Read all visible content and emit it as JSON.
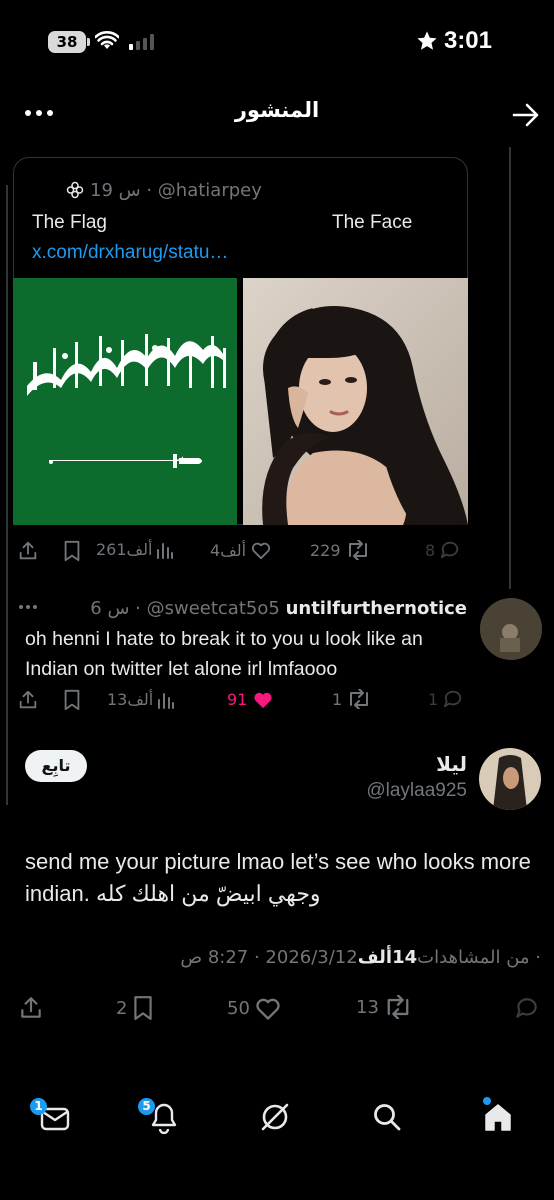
{
  "status_bar": {
    "battery": "38",
    "time": "3:01"
  },
  "header": {
    "title": "المنشور"
  },
  "quoted_post": {
    "meta": "19 س · @hatiarpey",
    "text_left": "The Flag",
    "text_right": "The Face",
    "link": "x.com/drxharug/statu…",
    "actions": {
      "views": "261ألف",
      "likes": "4ألف",
      "reposts": "229",
      "replies": "8"
    }
  },
  "reply": {
    "display_name": "untilfurthernotice",
    "handle": "@sweetcat5o5",
    "time": "6 س ·",
    "more": "···",
    "body": "oh henni I hate to break it to you u look like an Indian on twitter let alone irl lmfaooo",
    "actions": {
      "views": "13ألف",
      "likes": "91",
      "reposts": "1",
      "replies": "1"
    }
  },
  "main_post": {
    "display_name": "ليلا",
    "handle": "@laylaa925",
    "follow_label": "تابِع",
    "body": "send me your picture lmao let’s see who looks more indian. وجهي ابيضّ من اهلك كله",
    "date": "2026/3/12 · 8:27 ص · ",
    "views_count": "14ألف",
    "views_label": " من المشاهدات",
    "actions": {
      "bookmarks": "2",
      "likes": "50",
      "reposts": "13"
    }
  },
  "bottom_nav": {
    "messages_badge": "1",
    "notifications_badge": "5"
  },
  "colors": {
    "accent": "#1d9bf0",
    "like": "#f91880",
    "background": "#000000",
    "muted": "#71767b",
    "flag_green": "#0d6b2e"
  }
}
